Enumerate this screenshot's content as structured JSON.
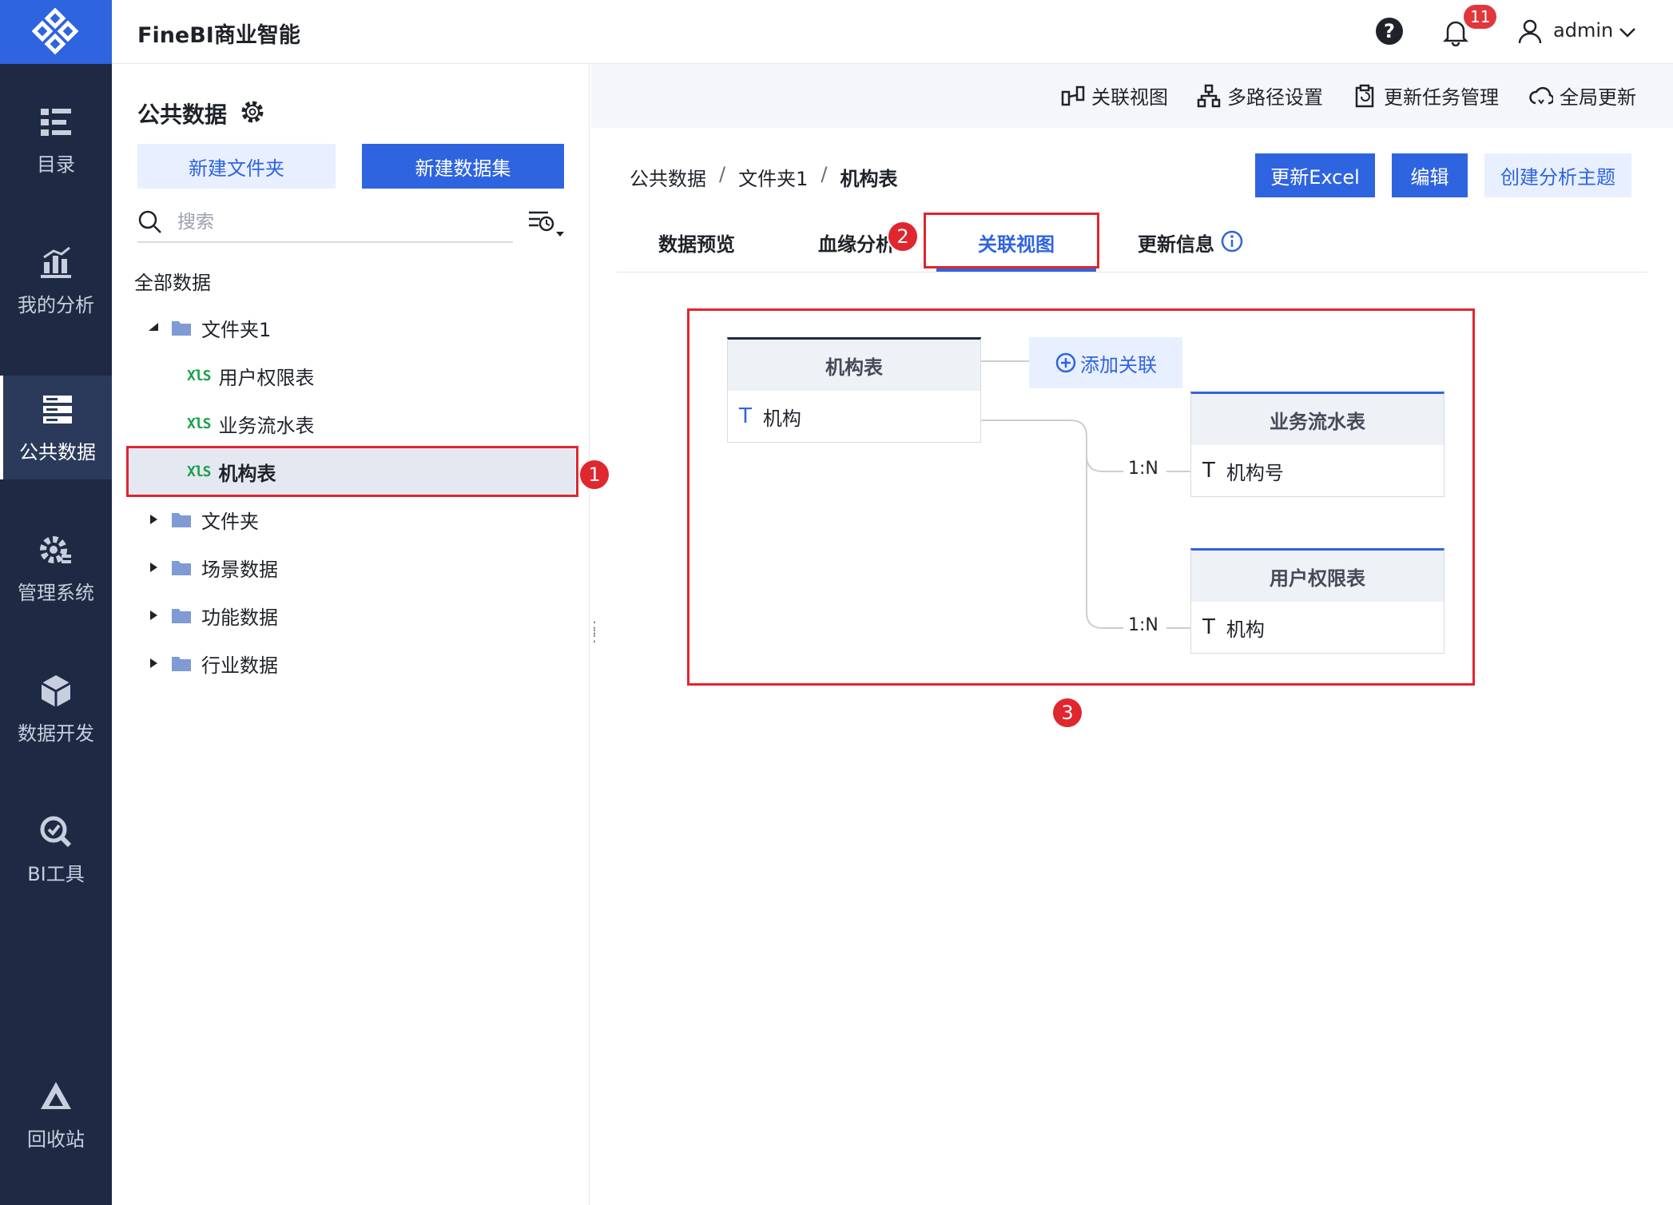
{
  "app": {
    "title": "FineBI商业智能",
    "notification_count": "11",
    "username": "admin"
  },
  "leftnav": {
    "items": [
      {
        "label": "目录"
      },
      {
        "label": "我的分析"
      },
      {
        "label": "公共数据"
      },
      {
        "label": "管理系统"
      },
      {
        "label": "数据开发"
      },
      {
        "label": "BI工具"
      },
      {
        "label": "回收站"
      }
    ]
  },
  "sidebar": {
    "title": "公共数据",
    "new_folder": "新建文件夹",
    "new_dataset": "新建数据集",
    "search_placeholder": "搜索",
    "all_data": "全部数据",
    "tree": [
      {
        "label": "文件夹1"
      },
      {
        "label": "用户权限表"
      },
      {
        "label": "业务流水表"
      },
      {
        "label": "机构表"
      },
      {
        "label": "文件夹"
      },
      {
        "label": "场景数据"
      },
      {
        "label": "功能数据"
      },
      {
        "label": "行业数据"
      }
    ]
  },
  "toolbar": {
    "relation_view": "关联视图",
    "multipath": "多路径设置",
    "update_tasks": "更新任务管理",
    "global_update": "全局更新"
  },
  "breadcrumb": {
    "root": "公共数据",
    "folder": "文件夹1",
    "current": "机构表",
    "sep": "/"
  },
  "actions": {
    "update_excel": "更新Excel",
    "edit": "编辑",
    "create_topic": "创建分析主题"
  },
  "tabs": [
    {
      "label": "数据预览"
    },
    {
      "label": "血缘分析"
    },
    {
      "label": "关联视图"
    },
    {
      "label": "更新信息"
    }
  ],
  "diagram": {
    "main_table": {
      "name": "机构表",
      "field": "机构"
    },
    "add_relation": "添加关联",
    "related": [
      {
        "name": "业务流水表",
        "field": "机构号",
        "relation": "1:N"
      },
      {
        "name": "用户权限表",
        "field": "机构",
        "relation": "1:N"
      }
    ]
  },
  "annotations": [
    "1",
    "2",
    "3"
  ],
  "colors": {
    "brand": "#2f64e0",
    "nav_bg": "#1e2a44",
    "annotation": "#e0262f",
    "xls": "#19a04b"
  }
}
